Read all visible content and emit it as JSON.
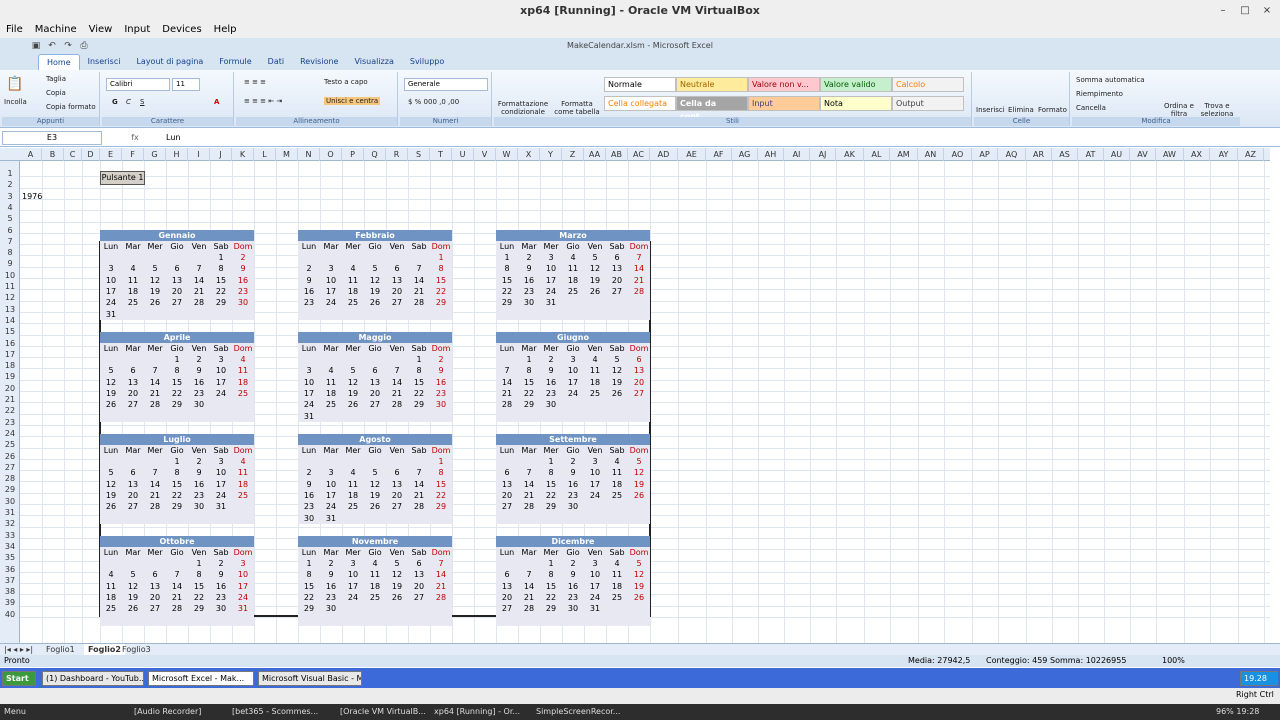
{
  "vbox": {
    "title": "xp64 [Running] - Oracle VM VirtualBox",
    "menu": [
      "File",
      "Machine",
      "View",
      "Input",
      "Devices",
      "Help"
    ]
  },
  "excel": {
    "title": "MakeCalendar.xlsm - Microsoft Excel",
    "tabs": [
      "Home",
      "Inserisci",
      "Layout di pagina",
      "Formule",
      "Dati",
      "Revisione",
      "Visualizza",
      "Sviluppo"
    ],
    "ribbon": {
      "paste": "Incolla",
      "cut": "Taglia",
      "copy": "Copia",
      "format_painter": "Copia formato",
      "group_clipboard": "Appunti",
      "font_name": "Calibri",
      "font_size": "11",
      "group_font": "Carattere",
      "bold": "G",
      "italic": "C",
      "underline": "S",
      "wrap": "Testo a capo",
      "merge": "Unisci e centra",
      "group_align": "Allineamento",
      "number_format": "Generale",
      "group_number": "Numeri",
      "cond_format": "Formattazione condizionale",
      "format_table": "Formatta come tabella",
      "styles": [
        "Normale",
        "Neutrale",
        "Valore non v...",
        "Valore valido",
        "Calcolo",
        "Cella collegata",
        "Cella da cont...",
        "Input",
        "Nota",
        "Output"
      ],
      "group_styles": "Stili",
      "insert": "Inserisci",
      "delete": "Elimina",
      "format": "Formato",
      "group_cells": "Celle",
      "autosum": "Somma automatica",
      "fill": "Riempimento",
      "clear": "Cancella",
      "sort": "Ordina e filtra",
      "find": "Trova e seleziona",
      "group_edit": "Modifica"
    },
    "namebox": "E3",
    "fx": "fx",
    "formula": "Lun",
    "columns": [
      "A",
      "B",
      "C",
      "D",
      "E",
      "F",
      "G",
      "H",
      "I",
      "J",
      "K",
      "L",
      "M",
      "N",
      "O",
      "P",
      "Q",
      "R",
      "S",
      "T",
      "U",
      "V",
      "W",
      "X",
      "Y",
      "Z",
      "AA",
      "AB",
      "AC",
      "AD",
      "AE",
      "AF",
      "AG",
      "AH",
      "AI",
      "AJ",
      "AK",
      "AL",
      "AM",
      "AN",
      "AO",
      "AP",
      "AQ",
      "AR",
      "AS",
      "AT",
      "AU",
      "AV",
      "AW",
      "AX",
      "AY",
      "AZ"
    ],
    "button": "Pulsante 1",
    "year": "1976",
    "days": [
      "Lun",
      "Mar",
      "Mer",
      "Gio",
      "Ven",
      "Sab",
      "Dom"
    ],
    "months": [
      {
        "name": "Gennaio",
        "start": 5,
        "len": 31
      },
      {
        "name": "Febbraio",
        "start": 6,
        "len": 29
      },
      {
        "name": "Marzo",
        "start": 0,
        "len": 31
      },
      {
        "name": "Aprile",
        "start": 3,
        "len": 30
      },
      {
        "name": "Maggio",
        "start": 5,
        "len": 31
      },
      {
        "name": "Giugno",
        "start": 1,
        "len": 30
      },
      {
        "name": "Luglio",
        "start": 3,
        "len": 31
      },
      {
        "name": "Agosto",
        "start": 6,
        "len": 31
      },
      {
        "name": "Settembre",
        "start": 2,
        "len": 30
      },
      {
        "name": "Ottobre",
        "start": 4,
        "len": 31
      },
      {
        "name": "Novembre",
        "start": 0,
        "len": 30
      },
      {
        "name": "Dicembre",
        "start": 2,
        "len": 31
      }
    ],
    "sheets": [
      "Foglio1",
      "Foglio2",
      "Foglio3"
    ],
    "status": {
      "ready": "Pronto",
      "avg": "Media: 27942,5",
      "count": "Conteggio: 459",
      "sum": "Somma: 10226955",
      "zoom": "100%"
    }
  },
  "taskbar": {
    "start": "Start",
    "items": [
      "(1) Dashboard - YouTub...",
      "Microsoft Excel - Mak...",
      "Microsoft Visual Basic - M..."
    ],
    "clock": "19.28",
    "host_key": "Right Ctrl"
  },
  "host": {
    "menu": "Menu",
    "items": [
      "[Audio Recorder]",
      "[bet365 - Scommes...",
      "[Oracle VM VirtualB...",
      "xp64 [Running] - Or...",
      "SimpleScreenRecor..."
    ],
    "status": "96% 19:28"
  }
}
